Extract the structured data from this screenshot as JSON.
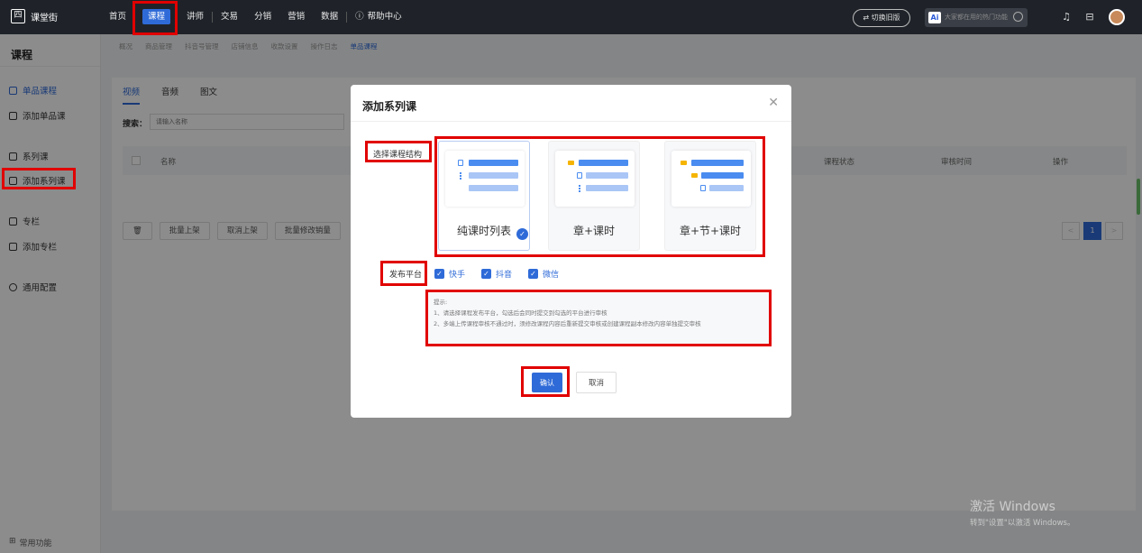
{
  "app": {
    "logo": "课堂街",
    "logo_glyph": "四"
  },
  "topnav": {
    "items": [
      "首页",
      "课程",
      "讲师",
      "交易",
      "分销",
      "营销",
      "数据"
    ],
    "help": "帮助中心",
    "switch_old": "⇄ 切换旧版",
    "search_placeholder": "大家都在用的热门功能",
    "ai": "Ai"
  },
  "sidebar": {
    "title": "课程",
    "items": [
      "单品课程",
      "添加单品课",
      "系列课",
      "添加系列课",
      "专栏",
      "添加专栏",
      "通用配置"
    ],
    "common": "常用功能"
  },
  "breadcrumb": [
    "概况",
    "商品管理",
    "抖音号管理",
    "店铺信息",
    "收款设置",
    "操作日志",
    "单品课程"
  ],
  "tabs": [
    "视频",
    "音频",
    "图文"
  ],
  "search": {
    "label": "搜索：",
    "placeholder": "请输入名称"
  },
  "table": {
    "headers": [
      "名称",
      "课程状态",
      "审核时间",
      "操作"
    ]
  },
  "toolbar": [
    "批量上架",
    "取消上架",
    "批量修改销量"
  ],
  "pager": {
    "current": "1",
    "prev": "<",
    "next": ">"
  },
  "modal": {
    "title": "添加系列课",
    "structure_label": "选择课程结构",
    "cards": [
      "纯课时列表",
      "章+课时",
      "章+节+课时"
    ],
    "platform_label": "发布平台",
    "platforms": [
      "快手",
      "抖音",
      "微信"
    ],
    "hint_title": "提示:",
    "hint_lines": [
      "1、请选择课程发布平台，勾选后会同时提交到勾选的平台进行审核",
      "2、多端上传课程审核不通过时，须修改课程内容后重新提交审核或创建课程副本修改内容单独提交审核"
    ],
    "confirm": "确认",
    "cancel": "取消"
  },
  "watermark": {
    "line1": "激活 Windows",
    "line2": "转到\"设置\"以激活 Windows。"
  },
  "colors": {
    "accent": "#2f6bd8",
    "highlight": "#e10000",
    "topbar": "#1f2329"
  }
}
